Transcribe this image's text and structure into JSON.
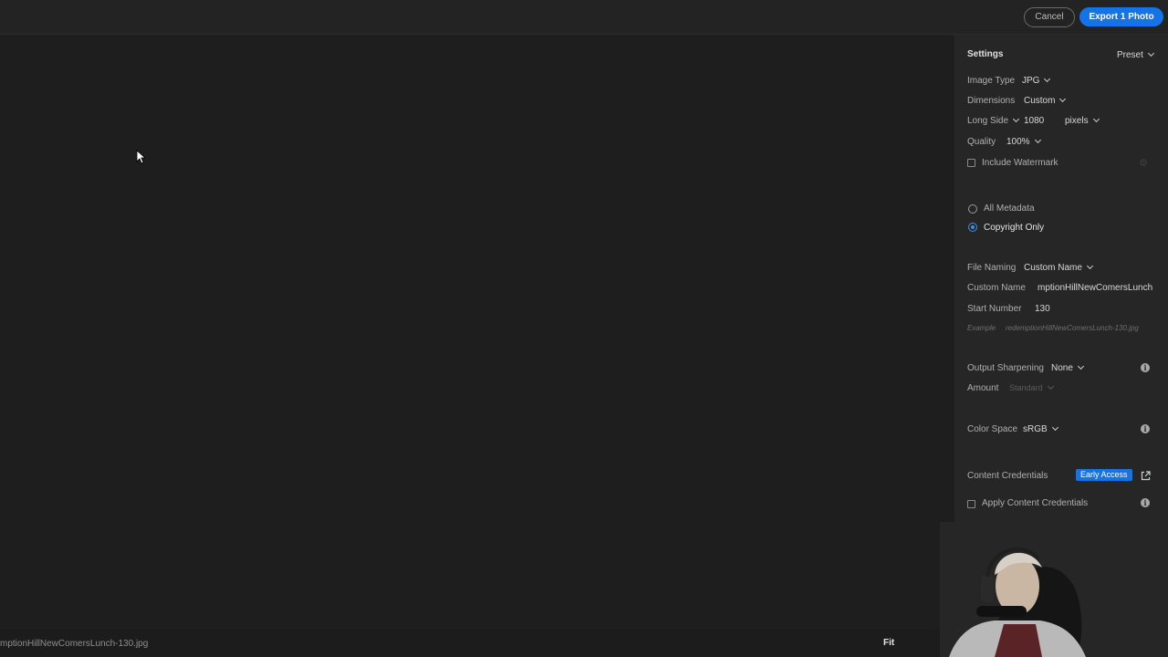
{
  "header": {
    "cancel_label": "Cancel",
    "export_label": "Export 1 Photo"
  },
  "preview": {
    "filename": "mptionHillNewComersLunch-130.jpg",
    "zoom_label": "Fit"
  },
  "settings": {
    "title": "Settings",
    "preset_label": "Preset",
    "image_type": {
      "label": "Image Type",
      "value": "JPG"
    },
    "dimensions": {
      "label": "Dimensions",
      "value": "Custom"
    },
    "long_side": {
      "label": "Long Side",
      "value": "1080",
      "unit": "pixels"
    },
    "quality": {
      "label": "Quality",
      "value": "100%"
    },
    "include_watermark": {
      "label": "Include Watermark",
      "checked": false
    },
    "metadata": {
      "options": [
        "All Metadata",
        "Copyright Only"
      ],
      "selected": "Copyright Only"
    },
    "file_naming": {
      "label": "File Naming",
      "value": "Custom Name"
    },
    "custom_name": {
      "label": "Custom Name",
      "value": "mptionHillNewComersLunch"
    },
    "start_number": {
      "label": "Start Number",
      "value": "130"
    },
    "example": {
      "label": "Example",
      "value": "redemptionHillNewComersLunch-130.jpg"
    },
    "output_sharpening": {
      "label": "Output Sharpening",
      "value": "None"
    },
    "amount": {
      "label": "Amount",
      "value": "Standard"
    },
    "color_space": {
      "label": "Color Space",
      "value": "sRGB"
    },
    "content_credentials": {
      "label": "Content Credentials",
      "badge": "Early Access"
    },
    "apply_content_credentials": {
      "label": "Apply Content Credentials",
      "checked": false
    }
  },
  "colors": {
    "accent": "#1473e6",
    "panel_bg": "#262626",
    "canvas_bg": "#1e1e1e"
  }
}
